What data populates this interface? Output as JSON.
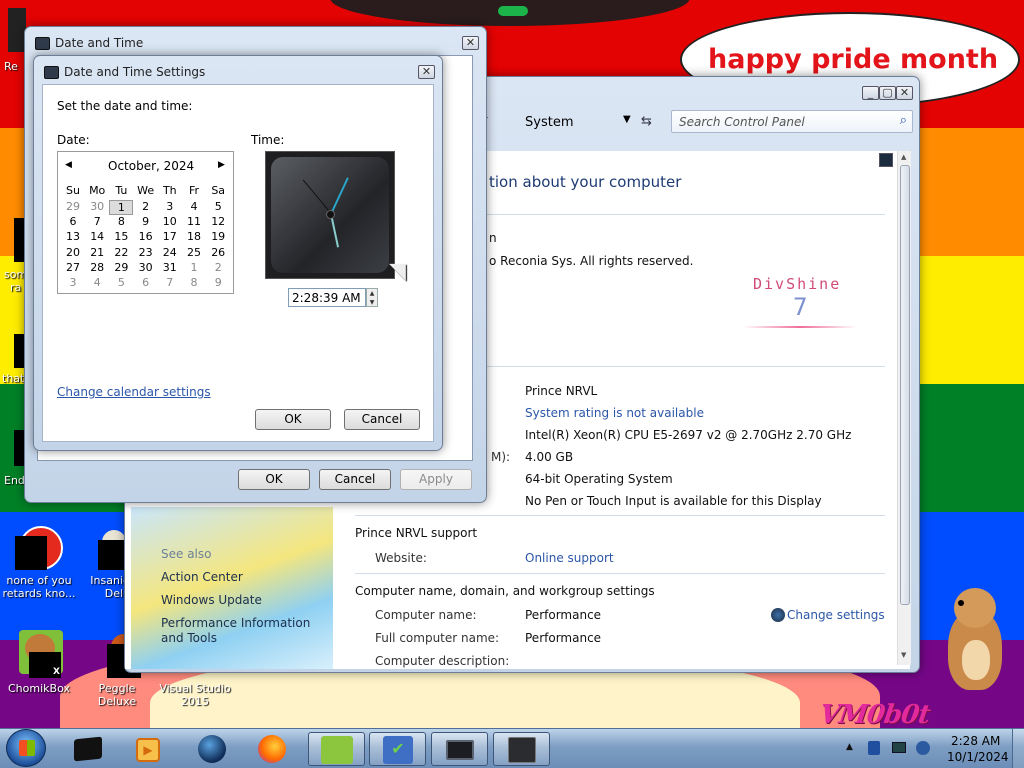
{
  "wallpaper": {
    "stripe_colors": [
      "#e40303",
      "#ff8c00",
      "#ffed00",
      "#008026",
      "#004dff",
      "#750787"
    ],
    "bubble_text": "happy pride month",
    "watermark_text": "VM0b0t"
  },
  "desktop_icons": [
    {
      "name": "desk-icon-recycle",
      "label": "Re"
    },
    {
      "name": "desk-icon-some",
      "label": "som\nra"
    },
    {
      "name": "desk-icon-that",
      "label": "that"
    },
    {
      "name": "desk-icon-end",
      "label": "End"
    },
    {
      "name": "desk-icon-none-of-you",
      "label": "none of you\nretards kno..."
    },
    {
      "name": "desk-icon-insaniquarium",
      "label": "Insaniq\nDelu"
    },
    {
      "name": "desk-icon-chomikbox",
      "label": "ChomikBox"
    },
    {
      "name": "desk-icon-peggle",
      "label": "Peggle Deluxe"
    },
    {
      "name": "desk-icon-visualstudio",
      "label": "Visual Studio\n2015"
    }
  ],
  "control_panel": {
    "breadcrumb_current": "System",
    "search_placeholder": "Search Control Panel",
    "heading": "tion about your computer",
    "edition_fragment": "n",
    "copyright": "o Reconia Sys.  All rights reserved.",
    "fragment_e": "e",
    "logo_title": "DivShine",
    "logo_version": "7",
    "system_rows": {
      "name_value": "Prince NRVL",
      "rating_value": "System rating is not available",
      "processor_value": "Intel(R) Xeon(R) CPU E5-2697 v2 @ 2.70GHz  2.70 GHz",
      "memory_label_fragment": "M):",
      "memory_value": "4.00 GB",
      "system_type_value": "64-bit Operating System",
      "pen_value": "No Pen or Touch Input is available for this Display"
    },
    "support_heading": "Prince NRVL support",
    "website_label": "Website:",
    "website_value": "Online support",
    "domain_heading": "Computer name, domain, and workgroup settings",
    "computer_name_label": "Computer name:",
    "computer_name_value": "Performance",
    "full_name_label": "Full computer name:",
    "full_name_value": "Performance",
    "description_label": "Computer description:",
    "change_settings": "Change settings",
    "see_also_heading": "See also",
    "see_also": [
      "Action Center",
      "Windows Update",
      "Performance Information and Tools"
    ]
  },
  "date_time_dialog": {
    "title": "Date and Time",
    "ok": "OK",
    "cancel": "Cancel",
    "apply": "Apply"
  },
  "settings_dialog": {
    "title": "Date and Time Settings",
    "instruction": "Set the date and time:",
    "date_label": "Date:",
    "time_label": "Time:",
    "month_label": "October, 2024",
    "weekdays": [
      "Su",
      "Mo",
      "Tu",
      "We",
      "Th",
      "Fr",
      "Sa"
    ],
    "weeks": [
      [
        "29",
        "30",
        "1",
        "2",
        "3",
        "4",
        "5"
      ],
      [
        "6",
        "7",
        "8",
        "9",
        "10",
        "11",
        "12"
      ],
      [
        "13",
        "14",
        "15",
        "16",
        "17",
        "18",
        "19"
      ],
      [
        "20",
        "21",
        "22",
        "23",
        "24",
        "25",
        "26"
      ],
      [
        "27",
        "28",
        "29",
        "30",
        "31",
        "1",
        "2"
      ],
      [
        "3",
        "4",
        "5",
        "6",
        "7",
        "8",
        "9"
      ]
    ],
    "time_value": "2:28:39 AM",
    "change_calendar_link": "Change calendar settings",
    "ok": "OK",
    "cancel": "Cancel"
  },
  "taskbar": {
    "clock_time": "2:28 AM",
    "clock_date": "10/1/2024",
    "pinned": [
      "terminal-icon",
      "media-player-icon",
      "globe-icon",
      "firefox-icon",
      "chomikbox-icon",
      "notebook-check-icon",
      "monitor-icon",
      "calculator-icon"
    ]
  }
}
